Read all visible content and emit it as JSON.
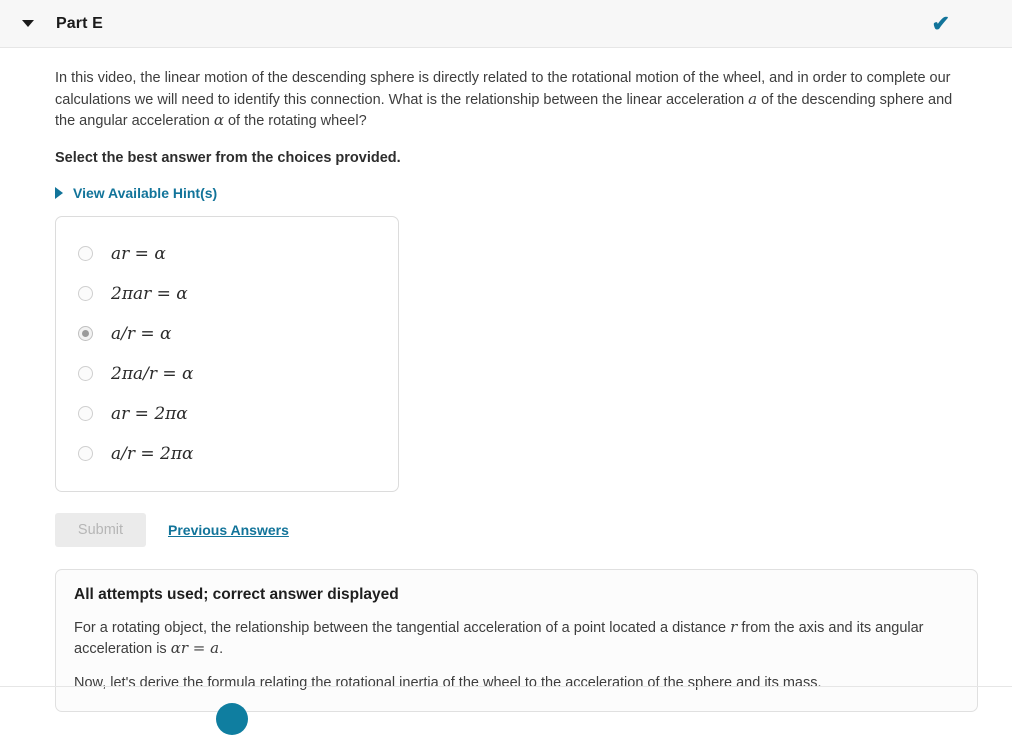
{
  "header": {
    "part_title": "Part E",
    "collapse_icon": "caret-down-icon",
    "status_icon": "checkmark-icon",
    "status_glyph": "✔",
    "accent_color": "#12749a"
  },
  "question": {
    "text_part_1": "In this video, the linear motion of the descending sphere is directly related to the rotational motion of the wheel, and in order to complete our calculations we will need to identify this connection. What is the relationship between the linear acceleration ",
    "math_a": "a",
    "text_part_2": " of the descending sphere and the angular acceleration ",
    "math_alpha": "α",
    "text_part_3": " of the rotating wheel?",
    "instruction": "Select the best answer from the choices provided."
  },
  "hints": {
    "label": "View Available Hint(s)",
    "caret_icon": "caret-right-icon"
  },
  "choices": [
    {
      "label": "ar = α",
      "selected": false
    },
    {
      "label": "2πar = α",
      "selected": false
    },
    {
      "label": "a/r = α",
      "selected": true
    },
    {
      "label": "2πa/r = α",
      "selected": false
    },
    {
      "label": "ar = 2πα",
      "selected": false
    },
    {
      "label": "a/r = 2πα",
      "selected": false
    }
  ],
  "actions": {
    "submit_label": "Submit",
    "submit_disabled": true,
    "previous_answers_label": "Previous Answers"
  },
  "feedback": {
    "title": "All attempts used; correct answer displayed",
    "para_1_part_1": "For a rotating object, the relationship between the tangential acceleration of a point located a distance ",
    "para_1_math_r": "r",
    "para_1_part_2": " from the axis and its angular acceleration is ",
    "para_1_math_eq": "αr = a",
    "para_1_part_3": ".",
    "para_2": "Now, let's derive the formula relating the rotational inertia of the wheel to the acceleration of the sphere and its mass."
  }
}
